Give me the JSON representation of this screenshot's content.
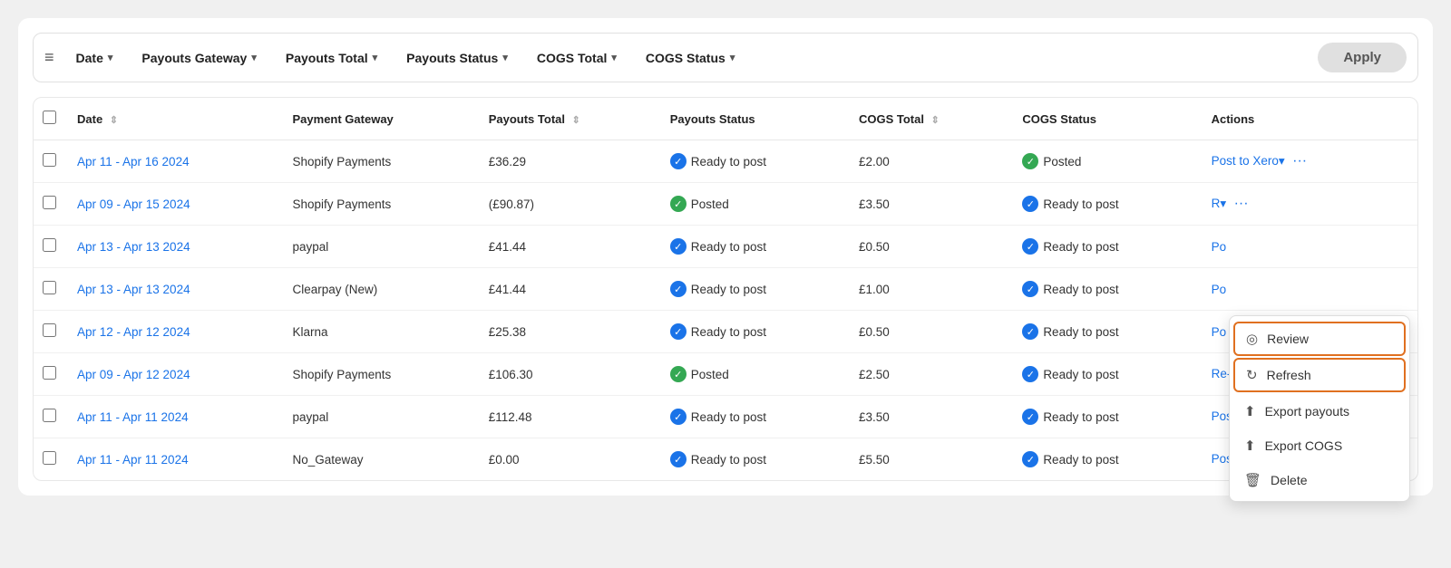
{
  "filter_bar": {
    "filter_icon": "≡",
    "filters": [
      {
        "id": "date",
        "label": "Date"
      },
      {
        "id": "payouts_gateway",
        "label": "Payouts Gateway"
      },
      {
        "id": "payouts_total",
        "label": "Payouts Total"
      },
      {
        "id": "payouts_status",
        "label": "Payouts Status"
      },
      {
        "id": "cogs_total",
        "label": "COGS Total"
      },
      {
        "id": "cogs_status",
        "label": "COGS Status"
      }
    ],
    "apply_label": "Apply"
  },
  "table": {
    "columns": [
      {
        "id": "date",
        "label": "Date",
        "sortable": true
      },
      {
        "id": "payment_gateway",
        "label": "Payment Gateway",
        "sortable": false
      },
      {
        "id": "payouts_total",
        "label": "Payouts Total",
        "sortable": true
      },
      {
        "id": "payouts_status",
        "label": "Payouts Status",
        "sortable": false
      },
      {
        "id": "cogs_total",
        "label": "COGS Total",
        "sortable": true
      },
      {
        "id": "cogs_status",
        "label": "COGS Status",
        "sortable": false
      },
      {
        "id": "actions",
        "label": "Actions",
        "sortable": false
      }
    ],
    "rows": [
      {
        "date": "Apr 11 - Apr 16 2024",
        "payment_gateway": "Shopify Payments",
        "payouts_total": "£36.29",
        "payouts_status": "Ready to post",
        "payouts_status_type": "blue",
        "cogs_total": "£2.00",
        "cogs_status": "Posted",
        "cogs_status_type": "green",
        "action_label": "Post to Xero",
        "action_type": "post"
      },
      {
        "date": "Apr 09 - Apr 15 2024",
        "payment_gateway": "Shopify Payments",
        "payouts_total": "(£90.87)",
        "payouts_status": "Posted",
        "payouts_status_type": "green",
        "cogs_total": "£3.50",
        "cogs_status": "Ready to post",
        "cogs_status_type": "blue",
        "action_label": "R",
        "action_type": "repost"
      },
      {
        "date": "Apr 13 - Apr 13 2024",
        "payment_gateway": "paypal",
        "payouts_total": "£41.44",
        "payouts_status": "Ready to post",
        "payouts_status_type": "blue",
        "cogs_total": "£0.50",
        "cogs_status": "Ready to post",
        "cogs_status_type": "blue",
        "action_label": "Po",
        "action_type": "post_short"
      },
      {
        "date": "Apr 13 - Apr 13 2024",
        "payment_gateway": "Clearpay (New)",
        "payouts_total": "£41.44",
        "payouts_status": "Ready to post",
        "payouts_status_type": "blue",
        "cogs_total": "£1.00",
        "cogs_status": "Ready to post",
        "cogs_status_type": "blue",
        "action_label": "Po",
        "action_type": "post_short"
      },
      {
        "date": "Apr 12 - Apr 12 2024",
        "payment_gateway": "Klarna",
        "payouts_total": "£25.38",
        "payouts_status": "Ready to post",
        "payouts_status_type": "blue",
        "cogs_total": "£0.50",
        "cogs_status": "Ready to post",
        "cogs_status_type": "blue",
        "action_label": "Po",
        "action_type": "post_short"
      },
      {
        "date": "Apr 09 - Apr 12 2024",
        "payment_gateway": "Shopify Payments",
        "payouts_total": "£106.30",
        "payouts_status": "Posted",
        "payouts_status_type": "green",
        "cogs_total": "£2.50",
        "cogs_status": "Ready to post",
        "cogs_status_type": "blue",
        "action_label": "Re-post to Xero",
        "action_type": "repost"
      },
      {
        "date": "Apr 11 - Apr 11 2024",
        "payment_gateway": "paypal",
        "payouts_total": "£112.48",
        "payouts_status": "Ready to post",
        "payouts_status_type": "blue",
        "cogs_total": "£3.50",
        "cogs_status": "Ready to post",
        "cogs_status_type": "blue",
        "action_label": "Post to Xero",
        "action_type": "post"
      },
      {
        "date": "Apr 11 - Apr 11 2024",
        "payment_gateway": "No_Gateway",
        "payouts_total": "£0.00",
        "payouts_status": "Ready to post",
        "payouts_status_type": "blue",
        "cogs_total": "£5.50",
        "cogs_status": "Ready to post",
        "cogs_status_type": "blue",
        "action_label": "Post to Xero",
        "action_type": "post"
      }
    ]
  },
  "dropdown_menu": {
    "items": [
      {
        "id": "review",
        "icon": "👁",
        "label": "Review",
        "highlighted": true
      },
      {
        "id": "refresh",
        "icon": "↻",
        "label": "Refresh",
        "highlighted": true
      },
      {
        "id": "export_payouts",
        "icon": "⬆",
        "label": "Export payouts",
        "highlighted": false
      },
      {
        "id": "export_cogs",
        "icon": "⬆",
        "label": "Export COGS",
        "highlighted": false
      },
      {
        "id": "delete",
        "icon": "🗑",
        "label": "Delete",
        "highlighted": false
      }
    ]
  }
}
